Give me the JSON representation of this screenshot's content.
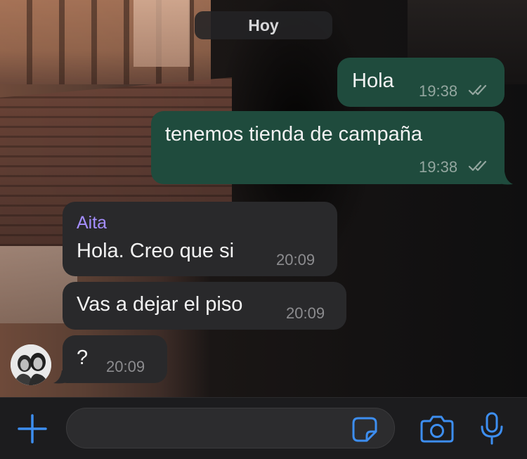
{
  "chat": {
    "date_divider": "Hoy",
    "messages": [
      {
        "direction": "outgoing",
        "text": "Hola",
        "time": "19:38",
        "status": "read"
      },
      {
        "direction": "outgoing",
        "text": "tenemos tienda de campaña",
        "time": "19:38",
        "status": "read"
      },
      {
        "direction": "incoming",
        "sender": "Aita",
        "text": "Hola. Creo que si",
        "time": "20:09"
      },
      {
        "direction": "incoming",
        "text": "Vas a dejar el piso",
        "time": "20:09"
      },
      {
        "direction": "incoming",
        "text": "?",
        "time": "20:09"
      }
    ]
  },
  "composer": {
    "input_value": "",
    "icons": [
      "plus-icon",
      "sticker-icon",
      "camera-icon",
      "microphone-icon"
    ]
  },
  "colors": {
    "outgoing_bubble": "#1f4b3d",
    "incoming_bubble": "#29292b",
    "sender_name": "#a58eff",
    "accent": "#3d8ef0",
    "composer_background": "#1c1c1e"
  }
}
